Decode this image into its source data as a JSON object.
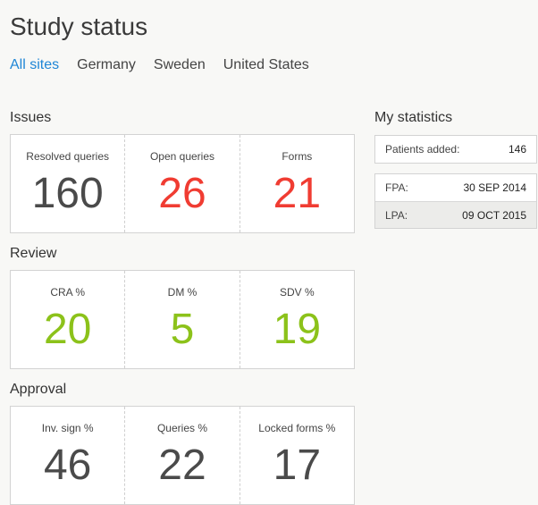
{
  "page": {
    "title": "Study status"
  },
  "tabs": [
    {
      "label": "All sites",
      "active": true
    },
    {
      "label": "Germany",
      "active": false
    },
    {
      "label": "Sweden",
      "active": false
    },
    {
      "label": "United States",
      "active": false
    }
  ],
  "issues": {
    "title": "Issues",
    "cells": [
      {
        "label": "Resolved queries",
        "value": "160",
        "color": "#4a4a4a"
      },
      {
        "label": "Open queries",
        "value": "26",
        "color": "#f03c32"
      },
      {
        "label": "Forms",
        "value": "21",
        "color": "#f03c32"
      }
    ]
  },
  "review": {
    "title": "Review",
    "cells": [
      {
        "label": "CRA %",
        "value": "20",
        "color": "#8cc21a"
      },
      {
        "label": "DM %",
        "value": "5",
        "color": "#8cc21a"
      },
      {
        "label": "SDV %",
        "value": "19",
        "color": "#8cc21a"
      }
    ]
  },
  "approval": {
    "title": "Approval",
    "cells": [
      {
        "label": "Inv. sign %",
        "value": "46",
        "color": "#4a4a4a"
      },
      {
        "label": "Queries %",
        "value": "22",
        "color": "#4a4a4a"
      },
      {
        "label": "Locked forms %",
        "value": "17",
        "color": "#4a4a4a"
      }
    ]
  },
  "my_statistics": {
    "title": "My statistics",
    "patients_label": "Patients added:",
    "patients_value": "146",
    "fpa_label": "FPA:",
    "fpa_value": "30 SEP 2014",
    "lpa_label": "LPA:",
    "lpa_value": "09 OCT 2015"
  },
  "colors": {
    "accent": "#1f86d6",
    "alert": "#f03c32",
    "good": "#8cc21a",
    "neutral": "#4a4a4a"
  }
}
